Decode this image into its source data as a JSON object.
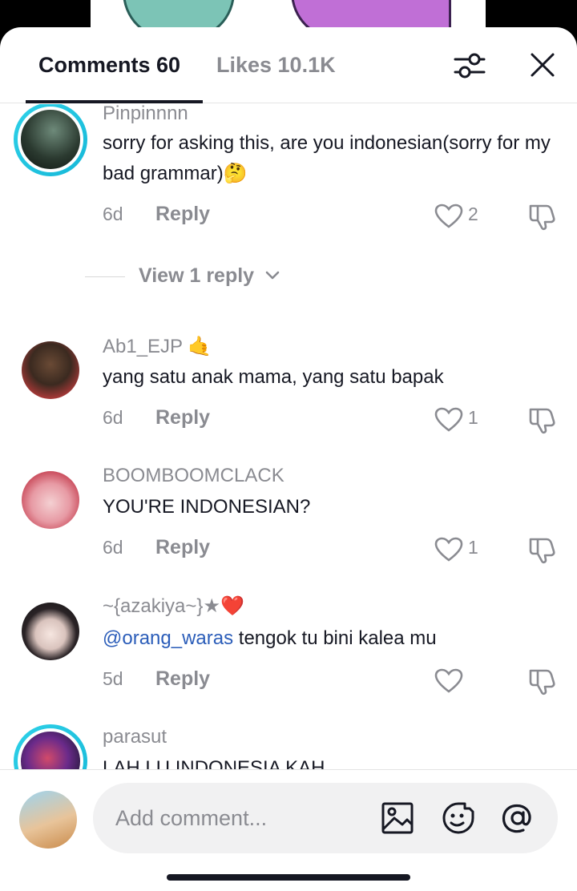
{
  "header": {
    "comments_tab": "Comments 60",
    "likes_tab": "Likes 10.1K"
  },
  "comments": [
    {
      "username": "Pinpinnnn",
      "text": "sorry for asking this, are you indonesian(sorry for my bad grammar)🤔",
      "age": "6d",
      "reply_label": "Reply",
      "likes": "2",
      "story_ring": true
    },
    {
      "username": "Ab1_EJP 🤙",
      "text": "yang satu anak mama, yang satu bapak",
      "age": "6d",
      "reply_label": "Reply",
      "likes": "1",
      "story_ring": false
    },
    {
      "username": "BOOMBOOMCLACK",
      "text": "YOU'RE INDONESIAN?",
      "age": "6d",
      "reply_label": "Reply",
      "likes": "1",
      "story_ring": false
    },
    {
      "username": "~{azakiya~}★❤️",
      "mention": "@orang_waras",
      "text": " tengok tu bini kalea mu",
      "age": "5d",
      "reply_label": "Reply",
      "likes": "",
      "story_ring": false
    },
    {
      "username": "parasut",
      "text": "LAH LU INDONESIA KAH",
      "story_ring": true
    }
  ],
  "view_replies_label": "View 1 reply",
  "composer": {
    "placeholder": "Add comment..."
  },
  "colors": {
    "accent_ring": "#1fc6e3",
    "mention": "#2b5db9",
    "text_primary": "#161823",
    "text_secondary": "#8a8b91"
  },
  "icons": [
    "filter-icon",
    "close-icon",
    "heart-icon",
    "dislike-icon",
    "chevron-down-icon",
    "image-icon",
    "emoji-icon",
    "at-icon"
  ]
}
